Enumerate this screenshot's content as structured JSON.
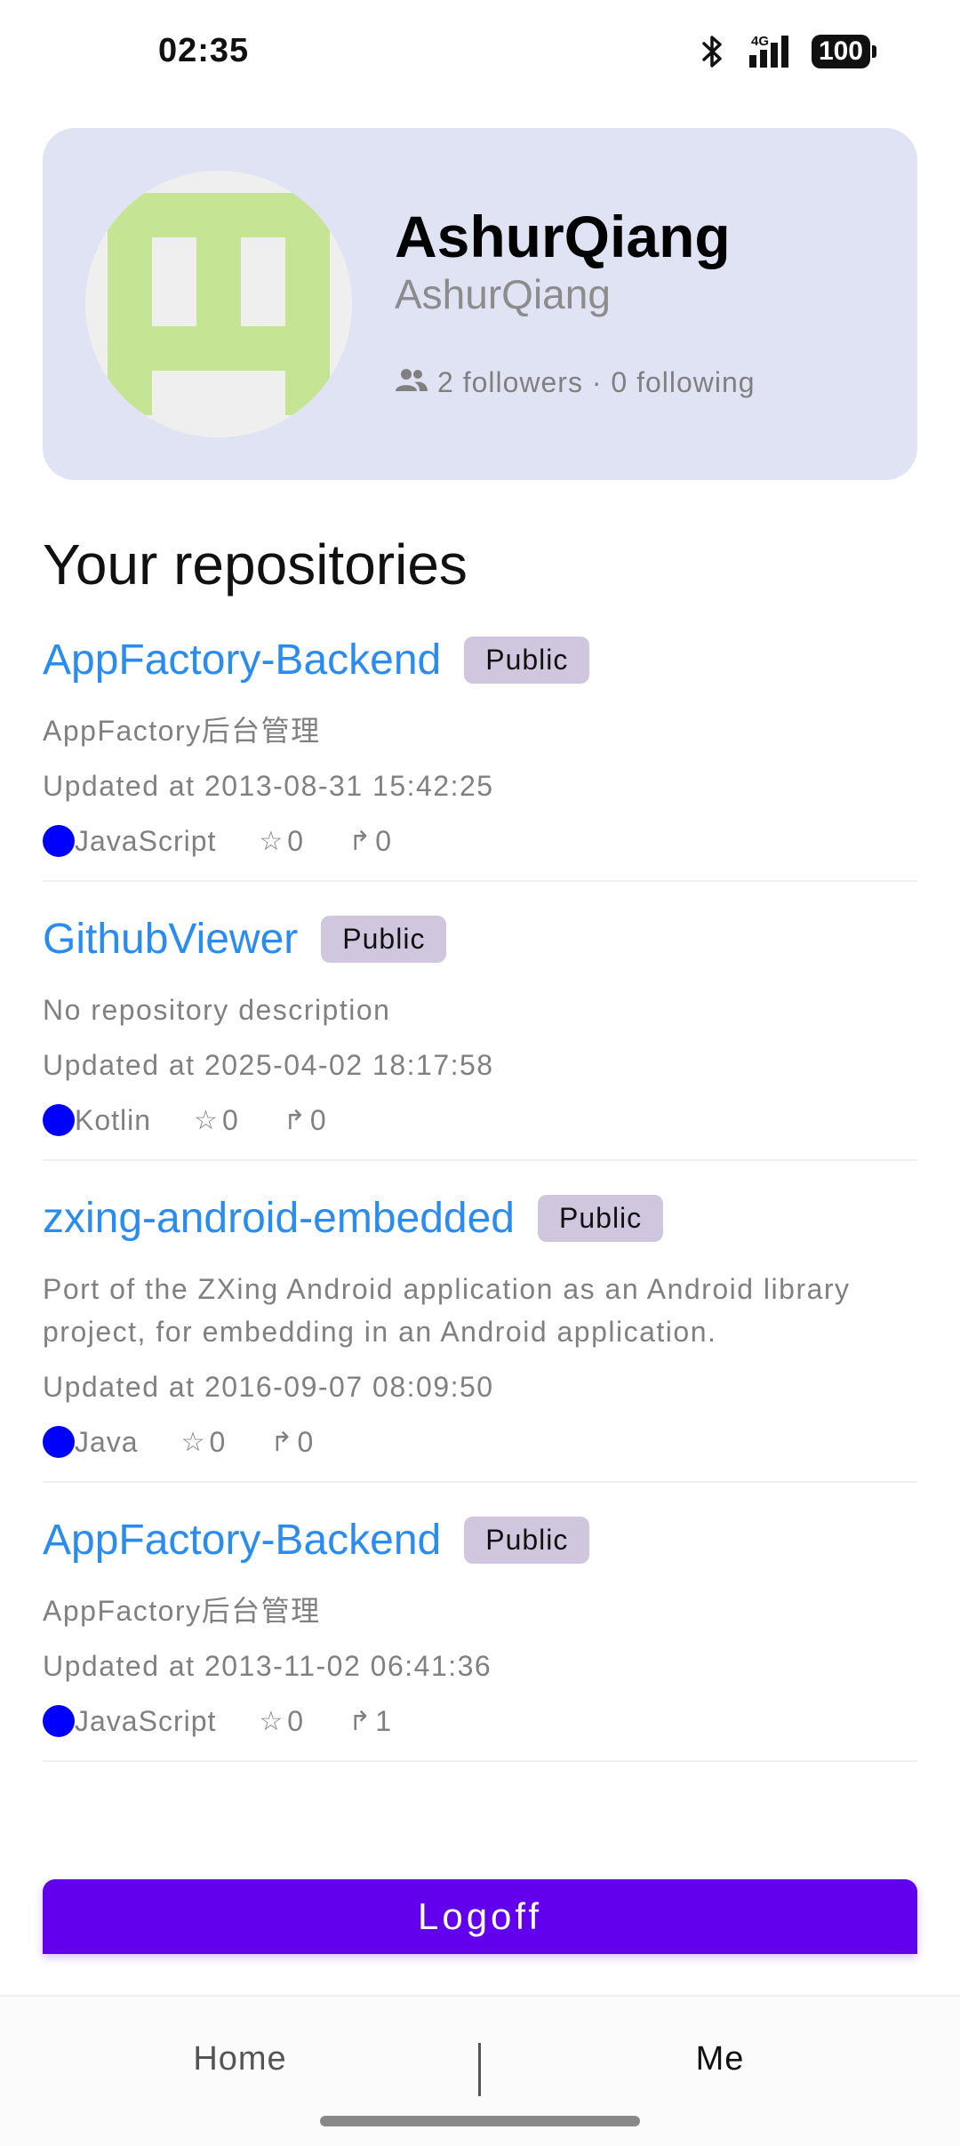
{
  "status_bar": {
    "time": "02:35",
    "network_label": "4G",
    "battery": "100"
  },
  "profile": {
    "name": "AshurQiang",
    "login": "AshurQiang",
    "follow_text": "2 followers · 0 following",
    "avatar_colors": {
      "background": "#efefef",
      "foreground": "#c6e594",
      "blocks": "#efefef"
    }
  },
  "repos_section": {
    "title": "Your repositories"
  },
  "repos": [
    {
      "name": "AppFactory-Backend",
      "visibility": "Public",
      "description": "AppFactory后台管理",
      "updated": "Updated at 2013-08-31 15:42:25",
      "language": "JavaScript",
      "stars": "0",
      "forks": "0"
    },
    {
      "name": "GithubViewer",
      "visibility": "Public",
      "description": "No repository description",
      "updated": "Updated at 2025-04-02 18:17:58",
      "language": "Kotlin",
      "stars": "0",
      "forks": "0"
    },
    {
      "name": "zxing-android-embedded",
      "visibility": "Public",
      "description": "Port of the ZXing Android application as an Android library project, for embedding in an Android application.",
      "updated": "Updated at 2016-09-07 08:09:50",
      "language": "Java",
      "stars": "0",
      "forks": "0"
    },
    {
      "name": "AppFactory-Backend",
      "visibility": "Public",
      "description": "AppFactory后台管理",
      "updated": "Updated at 2013-11-02 06:41:36",
      "language": "JavaScript",
      "stars": "0",
      "forks": "1"
    }
  ],
  "actions": {
    "logoff_label": "Logoff"
  },
  "bottom_nav": {
    "tabs": [
      {
        "label": "Home",
        "selected": false
      },
      {
        "label": "Me",
        "selected": true
      }
    ]
  },
  "colors": {
    "accent": "#6200ee",
    "link": "#2a8cf0",
    "card_bg": "#e0e3f4",
    "badge_bg": "#d0c7df",
    "language_dot": "#0000ff"
  },
  "icons": {
    "bluetooth": "bluetooth-icon",
    "signal": "signal-icon",
    "battery": "battery-icon",
    "people": "people-icon",
    "star": "star-icon",
    "fork": "fork-icon"
  }
}
